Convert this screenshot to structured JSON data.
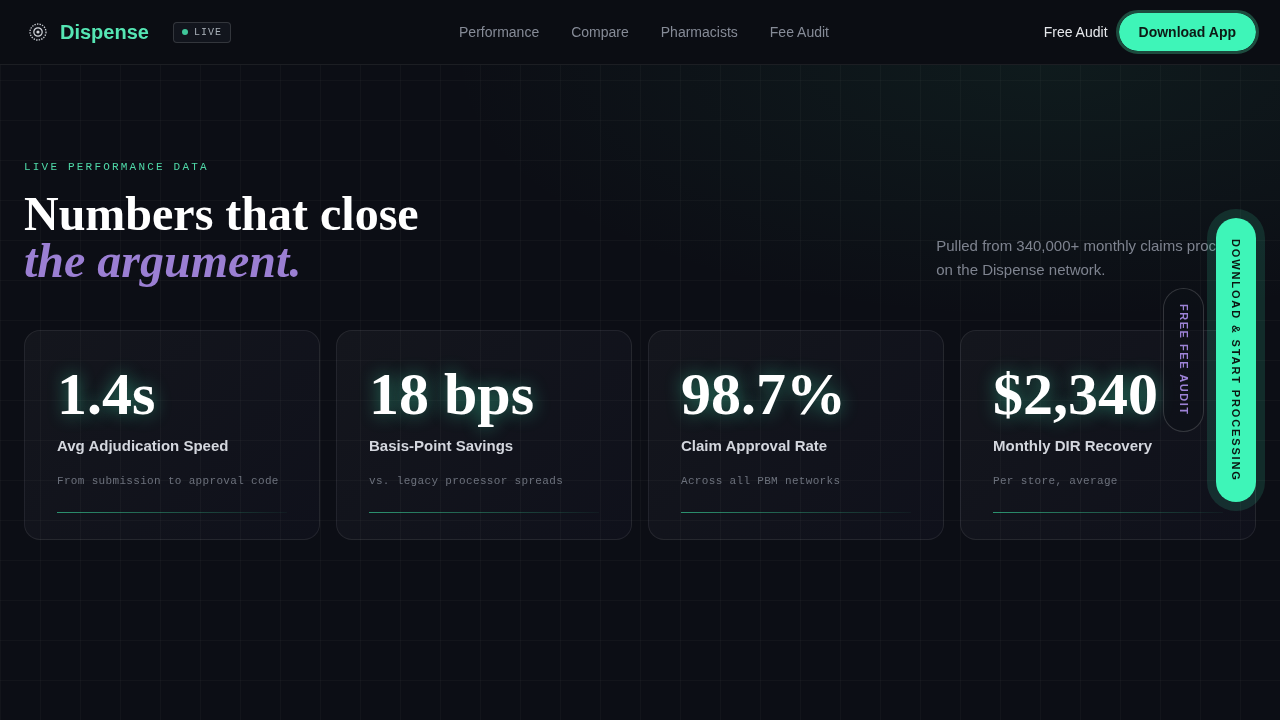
{
  "header": {
    "brand": "Dispense",
    "status_badge": {
      "label": "LIVE"
    },
    "nav": [
      {
        "label": "Performance"
      },
      {
        "label": "Compare"
      },
      {
        "label": "Pharmacists"
      },
      {
        "label": "Fee Audit"
      }
    ],
    "secondary_link": "Free Audit",
    "cta": "Download App"
  },
  "hero": {
    "eyebrow": "LIVE PERFORMANCE DATA",
    "title": "Numbers that close",
    "title_accent": "the argument.",
    "description_lines": [
      "Pulled from 340,000+ monthly claims proc",
      "on the Dispense network."
    ]
  },
  "stats": [
    {
      "value": "1.4s",
      "label": "Avg Adjudication Speed",
      "note": "From submission to approval code"
    },
    {
      "value": "18 bps",
      "label": "Basis-Point Savings",
      "note": "vs. legacy processor spreads"
    },
    {
      "value": "98.7%",
      "label": "Claim Approval Rate",
      "note": "Across all PBM networks"
    },
    {
      "value": "$2,340",
      "label": "Monthly DIR Recovery",
      "note": "Per store, average"
    }
  ],
  "floating_actions": [
    {
      "kind": "outline",
      "label": "FREE FEE AUDIT"
    },
    {
      "kind": "primary",
      "label": "DOWNLOAD & START PROCESSING"
    }
  ]
}
